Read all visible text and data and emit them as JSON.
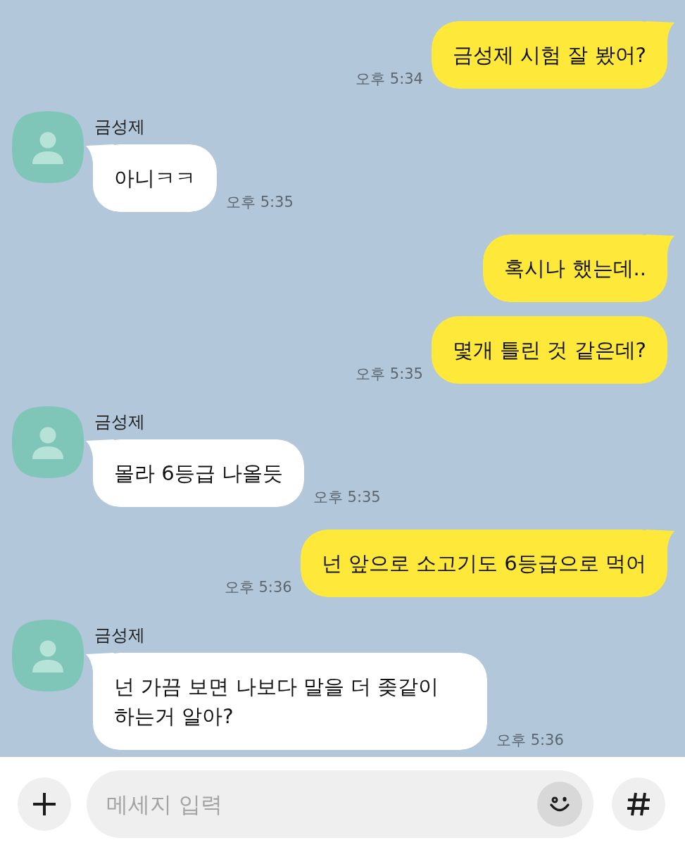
{
  "messages": [
    {
      "kind": "sent",
      "bubbles": [
        "금성제 시험 잘 봤어?"
      ],
      "time": "오후 5:34"
    },
    {
      "kind": "received",
      "name": "금성제",
      "bubbles": [
        "아니ㅋㅋ"
      ],
      "time": "오후 5:35"
    },
    {
      "kind": "sent",
      "bubbles": [
        "혹시나 했는데..",
        "몇개 틀린 것 같은데?"
      ],
      "time": "오후 5:35"
    },
    {
      "kind": "received",
      "name": "금성제",
      "bubbles": [
        "몰라 6등급 나올듯"
      ],
      "time": "오후 5:35"
    },
    {
      "kind": "sent",
      "bubbles": [
        "넌 앞으로 소고기도 6등급으로 먹어"
      ],
      "time": "오후 5:36"
    },
    {
      "kind": "received",
      "name": "금성제",
      "bubbles": [
        "넌 가끔 보면 나보다 말을 더 좆같이 하는거 알아?"
      ],
      "time": "오후 5:36"
    }
  ],
  "composer": {
    "placeholder": "메세지 입력"
  }
}
